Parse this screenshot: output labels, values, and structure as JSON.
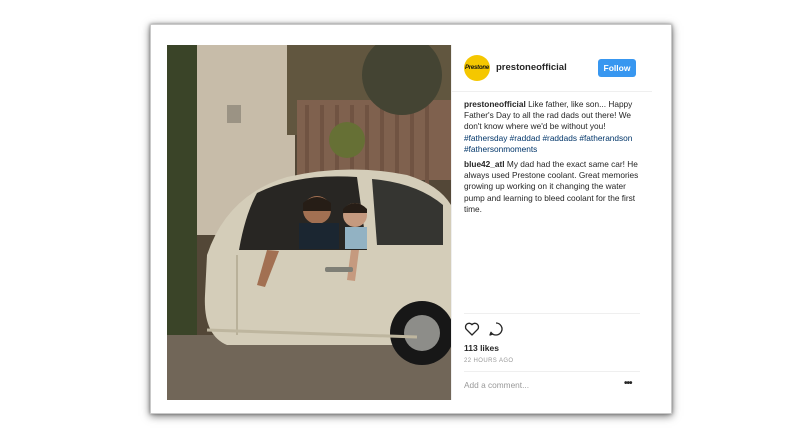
{
  "post": {
    "username": "prestoneofficial",
    "logo_text": "Prestone",
    "follow_label": "Follow",
    "caption": {
      "author": "prestoneofficial",
      "text": "Like father, like son... Happy Father's Day to all the rad dads out there! We don't know where we'd be without you!",
      "hashtags": [
        "#fathersday",
        "#raddad",
        "#raddads",
        "#fatherandson",
        "#fathersonmoments"
      ]
    },
    "comment": {
      "author": "blue42_atl",
      "text": "My dad had the exact same car! He always used Prestone coolant. Great memories growing up working on it changing the water pump and learning to bleed coolant for the first time."
    },
    "likes": "113 likes",
    "timestamp": "22 HOURS AGO",
    "add_comment_placeholder": "Add a comment...",
    "more_label": "•••"
  },
  "icons": {
    "like": "heart-icon",
    "comment": "comment-icon",
    "more": "more-options-icon"
  },
  "colors": {
    "follow_button": "#3897f0",
    "hashtag": "#003569",
    "logo_bg": "#f5c700"
  }
}
